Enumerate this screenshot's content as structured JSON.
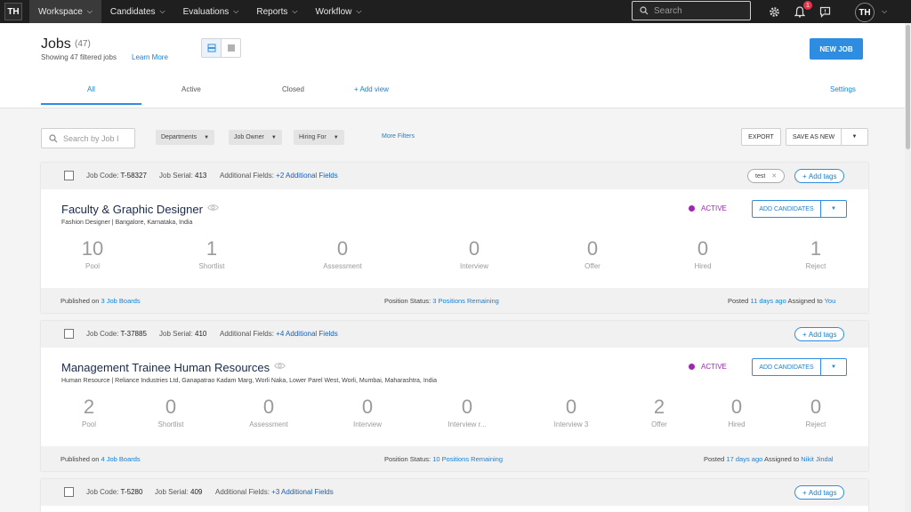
{
  "nav": {
    "logo": "TH",
    "items": [
      {
        "label": "Workspace",
        "active": true
      },
      {
        "label": "Candidates",
        "active": false
      },
      {
        "label": "Evaluations",
        "active": false
      },
      {
        "label": "Reports",
        "active": false
      },
      {
        "label": "Workflow",
        "active": false
      }
    ],
    "search_placeholder": "Search",
    "notification_count": "1",
    "avatar": "TH",
    "icons": [
      "gear-icon",
      "bell-icon",
      "chat-icon"
    ]
  },
  "header": {
    "title": "Jobs",
    "count": "(47)",
    "showing": "Showing 47 filtered jobs",
    "learn_more": "Learn More",
    "new_job": "NEW JOB"
  },
  "tabs": {
    "items": [
      "All",
      "Active",
      "Closed"
    ],
    "add_view": "Add view",
    "settings": "Settings"
  },
  "filters": {
    "search_placeholder": "Search by Job I",
    "departments": "Departments",
    "job_owner": "Job Owner",
    "hiring_for": "Hiring For",
    "more_filters": "More Filters",
    "export": "EXPORT",
    "save_as_new": "SAVE AS NEW"
  },
  "labels": {
    "job_code": "Job Code:",
    "job_serial": "Job Serial:",
    "additional_fields": "Additional Fields:",
    "add_tags": "Add tags",
    "add_candidates": "ADD CANDIDATES",
    "published_on": "Published on",
    "position_status": "Position Status:",
    "posted": "Posted",
    "assigned_to": "Assigned to"
  },
  "jobs": [
    {
      "code": "T-58327",
      "serial": "413",
      "additional": "+2 Additional Fields",
      "tag": "test",
      "title": "Faculty & Graphic Designer",
      "subtitle": "Fashion Designer | Bangalore, Karnataka, India",
      "status": "ACTIVE",
      "stats": [
        {
          "value": "10",
          "label": "Pool"
        },
        {
          "value": "1",
          "label": "Shortlist"
        },
        {
          "value": "0",
          "label": "Assessment"
        },
        {
          "value": "0",
          "label": "Interview"
        },
        {
          "value": "0",
          "label": "Offer"
        },
        {
          "value": "0",
          "label": "Hired"
        },
        {
          "value": "1",
          "label": "Reject"
        }
      ],
      "job_boards": "3 Job Boards",
      "positions": "3 Positions Remaining",
      "posted_ago": "11 days ago",
      "assignee": "You"
    },
    {
      "code": "T-37885",
      "serial": "410",
      "additional": "+4 Additional Fields",
      "title": "Management Trainee Human Resources",
      "subtitle": "Human Resource | Reliance Industries Ltd, Ganapatrao Kadam Marg, Worli Naka, Lower Parel West, Worli, Mumbai, Maharashtra, India",
      "status": "ACTIVE",
      "stats": [
        {
          "value": "2",
          "label": "Pool"
        },
        {
          "value": "0",
          "label": "Shortlist"
        },
        {
          "value": "0",
          "label": "Assessment"
        },
        {
          "value": "0",
          "label": "Interview"
        },
        {
          "value": "0",
          "label": "Interview r..."
        },
        {
          "value": "0",
          "label": "Interview 3"
        },
        {
          "value": "2",
          "label": "Offer"
        },
        {
          "value": "0",
          "label": "Hired"
        },
        {
          "value": "0",
          "label": "Reject"
        }
      ],
      "job_boards": "4 Job Boards",
      "positions": "10 Positions Remaining",
      "posted_ago": "17 days ago",
      "assignee": "Nikit Jindal"
    },
    {
      "code": "T-5280",
      "serial": "409",
      "additional": "+3 Additional Fields"
    }
  ],
  "colors": {
    "accent": "#2e8de0",
    "nav_bg": "#1f1f1f",
    "active_status": "#9c27b0",
    "badge": "#e8334a"
  }
}
